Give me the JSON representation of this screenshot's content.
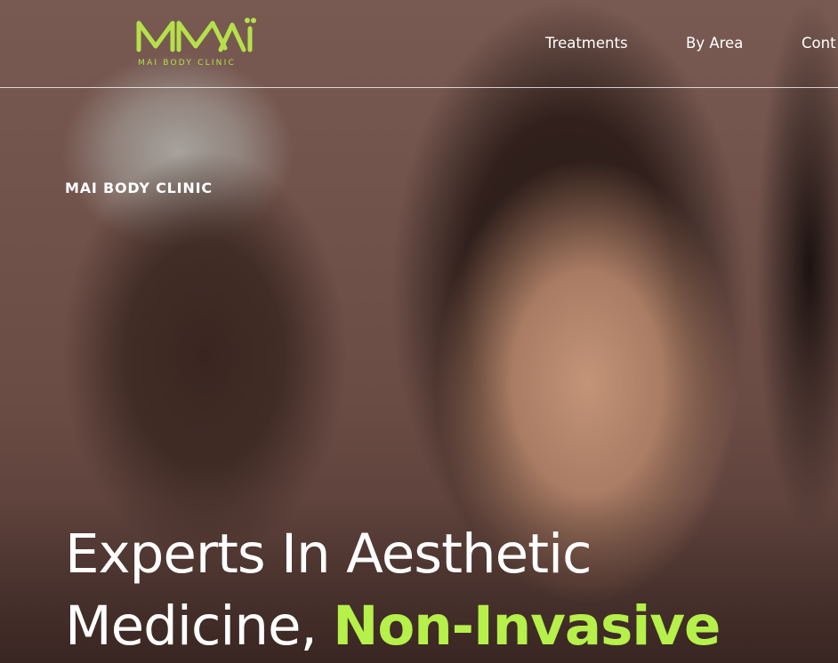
{
  "brand": {
    "name": "MAI BODY CLINIC",
    "accent_color": "#b6e04b"
  },
  "nav": {
    "items": [
      {
        "label": "Treatments"
      },
      {
        "label": "By Area"
      },
      {
        "label": "Cont"
      }
    ]
  },
  "hero": {
    "eyebrow": "MAI BODY CLINIC",
    "headline_part1": "Experts In Aesthetic Medicine, ",
    "headline_accent": "Non-Invasive",
    "accent_color": "#b6f04a",
    "image": "photo-of-three-women"
  }
}
